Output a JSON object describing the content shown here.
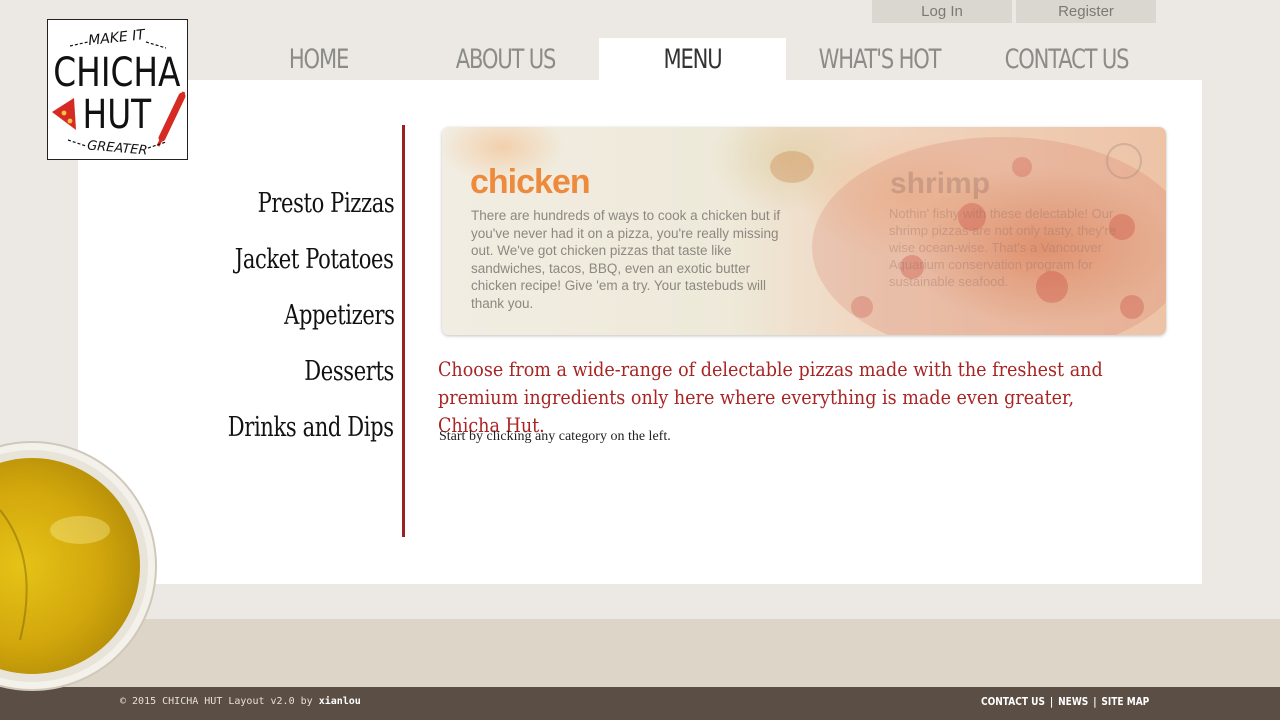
{
  "auth": {
    "login": "Log In",
    "register": "Register"
  },
  "logo": {
    "top": "MAKE IT",
    "line1": "CHICHA",
    "line2": "HUT",
    "bottom": "GREATER"
  },
  "nav": [
    {
      "label": "HOME"
    },
    {
      "label": "ABOUT US"
    },
    {
      "label": "MENU",
      "active": true
    },
    {
      "label": "WHAT'S HOT"
    },
    {
      "label": "CONTACT US"
    }
  ],
  "categories": [
    "Presto Pizzas",
    "Jacket Potatoes",
    "Appetizers",
    "Desserts",
    "Drinks and Dips"
  ],
  "banner": {
    "title": "chicken",
    "text": "There are hundreds of ways to cook a chicken but if you've never had it on a pizza, you're really missing out. We've got chicken pizzas that taste like sandwiches, tacos, BBQ, even an exotic butter chicken recipe! Give 'em a try. Your tastebuds will thank you.",
    "ghost_title": "shrimp",
    "ghost_text": "Nothin' fishy with these delectable! Our shrimp pizzas are not only tasty, they're wise ocean-wise. That's a Vancouver Aquarium conservation program for sustainable seafood."
  },
  "headline": "Choose from a wide-range of delectable pizzas made with the freshest and premium ingredients only here where everything is made even greater, Chicha Hut.",
  "hint": "Start by clicking any category on the left.",
  "footer": {
    "copyright_prefix": "© 2015 CHICHA HUT Layout v2.0 by ",
    "author": "xianlou",
    "links": [
      "CONTACT US",
      "NEWS",
      "SITE MAP"
    ],
    "separator": "|"
  },
  "colors": {
    "accent_red": "#a82524",
    "divider": "#9b2220",
    "footer": "#5b4e45",
    "banner_title": "#ee8a3b"
  }
}
